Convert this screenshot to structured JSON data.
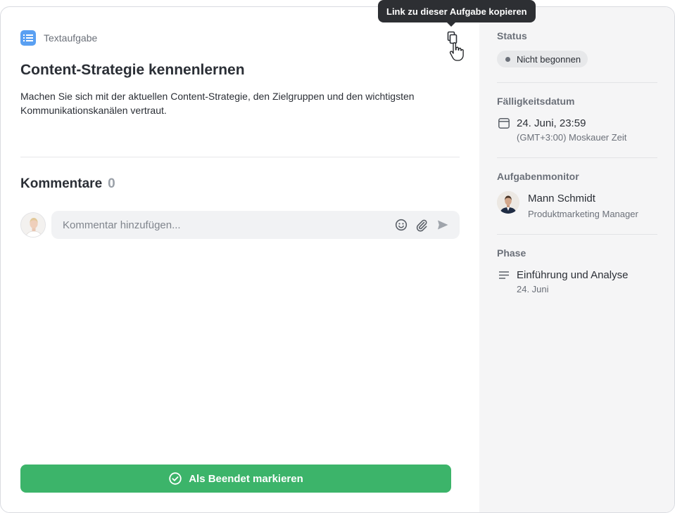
{
  "header": {
    "task_type": "Textaufgabe",
    "copy_tooltip": "Link zu dieser Aufgabe kopieren"
  },
  "task": {
    "title": "Content-Strategie kennenlernen",
    "description": "Machen Sie sich mit der aktuellen Content-Strategie, den Zielgruppen und den wichtigsten Kommunikationskanälen vertraut."
  },
  "comments": {
    "heading": "Kommentare",
    "count": "0",
    "placeholder": "Kommentar hinzufügen..."
  },
  "actions": {
    "mark_done_label": "Als Beendet markieren"
  },
  "sidebar": {
    "status": {
      "label": "Status",
      "value": "Nicht begonnen"
    },
    "due": {
      "label": "Fälligkeitsdatum",
      "date": "24. Juni, 23:59",
      "timezone": "(GMT+3:00) Moskauer Zeit"
    },
    "monitor": {
      "label": "Aufgabenmonitor",
      "name": "Mann Schmidt",
      "role": "Produktmarketing Manager"
    },
    "phase": {
      "label": "Phase",
      "name": "Einführung und Analyse",
      "date": "24. Juni"
    }
  },
  "colors": {
    "accent_green": "#3cb46a",
    "task_type_blue": "#5aa0f2",
    "sidebar_bg": "#f5f5f6",
    "tooltip_bg": "#2d2f33"
  },
  "icons": {
    "task_type": "list-icon",
    "copy": "copy-icon",
    "cursor": "hand-cursor-icon",
    "emoji": "smiley-icon",
    "attach": "paperclip-icon",
    "send": "send-icon",
    "done": "check-circle-icon",
    "calendar": "calendar-icon",
    "phase": "lines-icon"
  }
}
